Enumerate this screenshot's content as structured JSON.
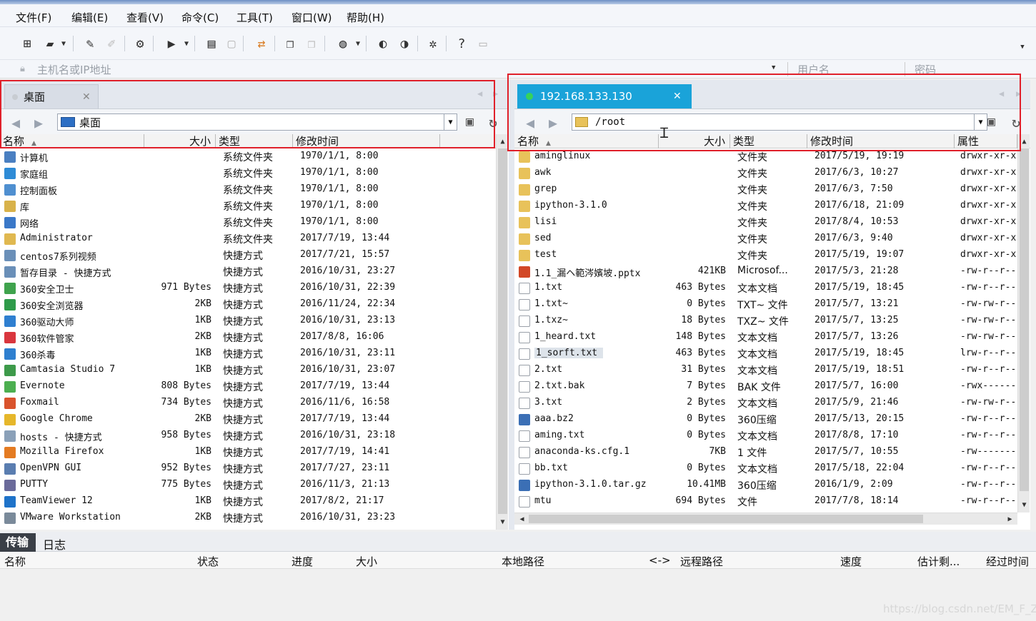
{
  "menu": [
    "文件(F)",
    "编辑(E)",
    "查看(V)",
    "命令(C)",
    "工具(T)",
    "窗口(W)",
    "帮助(H)"
  ],
  "address": {
    "host_placeholder": "主机名或IP地址",
    "user_placeholder": "用户名",
    "pass_placeholder": "密码"
  },
  "left": {
    "tab": "桌面",
    "path": "桌面",
    "headers": [
      "名称",
      "大小",
      "类型",
      "修改时间"
    ],
    "rows": [
      {
        "name": "计算机",
        "size": "",
        "type": "系统文件夹",
        "time": "1970/1/1, 8:00",
        "icon": "computer-icon",
        "color": "#4a7fc1"
      },
      {
        "name": "家庭组",
        "size": "",
        "type": "系统文件夹",
        "time": "1970/1/1, 8:00",
        "icon": "homegroup-icon",
        "color": "#2e8bd6"
      },
      {
        "name": "控制面板",
        "size": "",
        "type": "系统文件夹",
        "time": "1970/1/1, 8:00",
        "icon": "control-panel-icon",
        "color": "#4f8fd0"
      },
      {
        "name": "库",
        "size": "",
        "type": "系统文件夹",
        "time": "1970/1/1, 8:00",
        "icon": "library-icon",
        "color": "#d8b24a"
      },
      {
        "name": "网络",
        "size": "",
        "type": "系统文件夹",
        "time": "1970/1/1, 8:00",
        "icon": "network-icon",
        "color": "#3a78c8"
      },
      {
        "name": "Administrator",
        "size": "",
        "type": "系统文件夹",
        "time": "2017/7/19, 13:44",
        "icon": "user-folder-icon",
        "color": "#e0b850"
      },
      {
        "name": "centos7系列视频",
        "size": "",
        "type": "快捷方式",
        "time": "2017/7/21, 15:57",
        "icon": "shortcut-icon",
        "color": "#6a8fb8"
      },
      {
        "name": "暂存目录 - 快捷方式",
        "size": "",
        "type": "快捷方式",
        "time": "2016/10/31, 23:27",
        "icon": "shortcut-icon",
        "color": "#6a8fb8"
      },
      {
        "name": "360安全卫士",
        "size": "971 Bytes",
        "type": "快捷方式",
        "time": "2016/10/31, 22:39",
        "icon": "shield-icon",
        "color": "#3fa34d"
      },
      {
        "name": "360安全浏览器",
        "size": "2KB",
        "type": "快捷方式",
        "time": "2016/11/24, 22:34",
        "icon": "browser-icon",
        "color": "#2e9b4a"
      },
      {
        "name": "360驱动大师",
        "size": "1KB",
        "type": "快捷方式",
        "time": "2016/10/31, 23:13",
        "icon": "driver-icon",
        "color": "#2f7fd0"
      },
      {
        "name": "360软件管家",
        "size": "2KB",
        "type": "快捷方式",
        "time": "2017/8/8, 16:06",
        "icon": "software-icon",
        "color": "#d9363e"
      },
      {
        "name": "360杀毒",
        "size": "1KB",
        "type": "快捷方式",
        "time": "2016/10/31, 23:11",
        "icon": "antivirus-icon",
        "color": "#2e7fcf"
      },
      {
        "name": "Camtasia Studio 7",
        "size": "1KB",
        "type": "快捷方式",
        "time": "2016/10/31, 23:07",
        "icon": "camtasia-icon",
        "color": "#3d9a4a"
      },
      {
        "name": "Evernote",
        "size": "808 Bytes",
        "type": "快捷方式",
        "time": "2017/7/19, 13:44",
        "icon": "evernote-icon",
        "color": "#4caf50"
      },
      {
        "name": "Foxmail",
        "size": "734 Bytes",
        "type": "快捷方式",
        "time": "2016/11/6, 16:58",
        "icon": "foxmail-icon",
        "color": "#d9532c"
      },
      {
        "name": "Google Chrome",
        "size": "2KB",
        "type": "快捷方式",
        "time": "2017/7/19, 13:44",
        "icon": "chrome-icon",
        "color": "#e6b72a"
      },
      {
        "name": "hosts - 快捷方式",
        "size": "958 Bytes",
        "type": "快捷方式",
        "time": "2016/10/31, 23:18",
        "icon": "file-shortcut-icon",
        "color": "#8aa0b8"
      },
      {
        "name": "Mozilla Firefox",
        "size": "1KB",
        "type": "快捷方式",
        "time": "2017/7/19, 14:41",
        "icon": "firefox-icon",
        "color": "#e47b22"
      },
      {
        "name": "OpenVPN GUI",
        "size": "952 Bytes",
        "type": "快捷方式",
        "time": "2017/7/27, 23:11",
        "icon": "openvpn-icon",
        "color": "#5a7db0"
      },
      {
        "name": "PUTTY",
        "size": "775 Bytes",
        "type": "快捷方式",
        "time": "2016/11/3, 21:13",
        "icon": "putty-icon",
        "color": "#6a6a9a"
      },
      {
        "name": "TeamViewer 12",
        "size": "1KB",
        "type": "快捷方式",
        "time": "2017/8/2, 21:17",
        "icon": "teamviewer-icon",
        "color": "#1f73c9"
      },
      {
        "name": "VMware Workstation",
        "size": "2KB",
        "type": "快捷方式",
        "time": "2016/10/31, 23:23",
        "icon": "vmware-icon",
        "color": "#7a8a9a"
      }
    ]
  },
  "right": {
    "tab": "192.168.133.130",
    "path": "/root",
    "headers": [
      "名称",
      "大小",
      "类型",
      "修改时间",
      "属性"
    ],
    "rows": [
      {
        "name": "aminglinux",
        "size": "",
        "type": "文件夹",
        "time": "2017/5/19, 19:19",
        "attr": "drwxr-xr-x",
        "icon": "folder-icon",
        "color": "#e8c25a"
      },
      {
        "name": "awk",
        "size": "",
        "type": "文件夹",
        "time": "2017/6/3, 10:27",
        "attr": "drwxr-xr-x",
        "icon": "folder-icon",
        "color": "#e8c25a"
      },
      {
        "name": "grep",
        "size": "",
        "type": "文件夹",
        "time": "2017/6/3, 7:50",
        "attr": "drwxr-xr-x",
        "icon": "folder-icon",
        "color": "#e8c25a"
      },
      {
        "name": "ipython-3.1.0",
        "size": "",
        "type": "文件夹",
        "time": "2017/6/18, 21:09",
        "attr": "drwxr-xr-x",
        "icon": "folder-icon",
        "color": "#e8c25a"
      },
      {
        "name": "lisi",
        "size": "",
        "type": "文件夹",
        "time": "2017/8/4, 10:53",
        "attr": "drwxr-xr-x",
        "icon": "folder-icon",
        "color": "#e8c25a"
      },
      {
        "name": "sed",
        "size": "",
        "type": "文件夹",
        "time": "2017/6/3, 9:40",
        "attr": "drwxr-xr-x",
        "icon": "folder-icon",
        "color": "#e8c25a"
      },
      {
        "name": "test",
        "size": "",
        "type": "文件夹",
        "time": "2017/5/19, 19:07",
        "attr": "drwxr-xr-x",
        "icon": "folder-icon",
        "color": "#e8c25a"
      },
      {
        "name": "1.1_漏ヘ範涔嬪坡.pptx",
        "size": "421KB",
        "type": "Microsof...",
        "time": "2017/5/3, 21:28",
        "attr": "-rw-r--r--",
        "icon": "pptx-icon",
        "color": "#d24726"
      },
      {
        "name": "1.txt",
        "size": "463 Bytes",
        "type": "文本文档",
        "time": "2017/5/19, 18:45",
        "attr": "-rw-r--r--",
        "icon": "text-file-icon",
        "color": "#ffffff"
      },
      {
        "name": "1.txt~",
        "size": "0 Bytes",
        "type": "TXT~ 文件",
        "time": "2017/5/7, 13:21",
        "attr": "-rw-rw-r--",
        "icon": "text-file-icon",
        "color": "#ffffff"
      },
      {
        "name": "1.txz~",
        "size": "18 Bytes",
        "type": "TXZ~ 文件",
        "time": "2017/5/7, 13:25",
        "attr": "-rw-rw-r--",
        "icon": "text-file-icon",
        "color": "#ffffff"
      },
      {
        "name": "1_heard.txt",
        "size": "148 Bytes",
        "type": "文本文档",
        "time": "2017/5/7, 13:26",
        "attr": "-rw-rw-r--",
        "icon": "text-file-icon",
        "color": "#ffffff"
      },
      {
        "name": "1_sorft.txt",
        "size": "463 Bytes",
        "type": "文本文档",
        "time": "2017/5/19, 18:45",
        "attr": "lrw-r--r--",
        "icon": "link-file-icon",
        "color": "#ffffff",
        "selected": true
      },
      {
        "name": "2.txt",
        "size": "31 Bytes",
        "type": "文本文档",
        "time": "2017/5/19, 18:51",
        "attr": "-rw-r--r--",
        "icon": "text-file-icon",
        "color": "#ffffff"
      },
      {
        "name": "2.txt.bak",
        "size": "7 Bytes",
        "type": "BAK 文件",
        "time": "2017/5/7, 16:00",
        "attr": "-rwx------",
        "icon": "text-file-icon",
        "color": "#ffffff"
      },
      {
        "name": "3.txt",
        "size": "2 Bytes",
        "type": "文本文档",
        "time": "2017/5/9, 21:46",
        "attr": "-rw-rw-r--",
        "icon": "text-file-icon",
        "color": "#ffffff"
      },
      {
        "name": "aaa.bz2",
        "size": "0 Bytes",
        "type": "360压缩",
        "time": "2017/5/13, 20:15",
        "attr": "-rw-r--r--",
        "icon": "archive-icon",
        "color": "#3b6fb5"
      },
      {
        "name": "aming.txt",
        "size": "0 Bytes",
        "type": "文本文档",
        "time": "2017/8/8, 17:10",
        "attr": "-rw-r--r--",
        "icon": "text-file-icon",
        "color": "#ffffff"
      },
      {
        "name": "anaconda-ks.cfg.1",
        "size": "7KB",
        "type": "1 文件",
        "time": "2017/5/7, 10:55",
        "attr": "-rw-------",
        "icon": "text-file-icon",
        "color": "#ffffff"
      },
      {
        "name": "bb.txt",
        "size": "0 Bytes",
        "type": "文本文档",
        "time": "2017/5/18, 22:04",
        "attr": "-rw-r--r--",
        "icon": "text-file-icon",
        "color": "#ffffff"
      },
      {
        "name": "ipython-3.1.0.tar.gz",
        "size": "10.41MB",
        "type": "360压缩",
        "time": "2016/1/9, 2:09",
        "attr": "-rw-r--r--",
        "icon": "archive-icon",
        "color": "#3b6fb5"
      },
      {
        "name": "mtu",
        "size": "694 Bytes",
        "type": "文件",
        "time": "2017/7/8, 18:14",
        "attr": "-rw-r--r--",
        "icon": "text-file-icon",
        "color": "#ffffff"
      }
    ]
  },
  "transfer": {
    "tabs": [
      "传输",
      "日志"
    ],
    "columns": [
      "名称",
      "状态",
      "进度",
      "大小",
      "本地路径",
      "<->",
      "远程路径",
      "速度",
      "估计剩...",
      "经过时间"
    ]
  },
  "watermark": "https://blog.csdn.net/EM_F_Z",
  "colors": {
    "accent": "#1aa3d9",
    "highlight_box": "#e0202a",
    "tab_active_remote": "#1aa3d9"
  }
}
